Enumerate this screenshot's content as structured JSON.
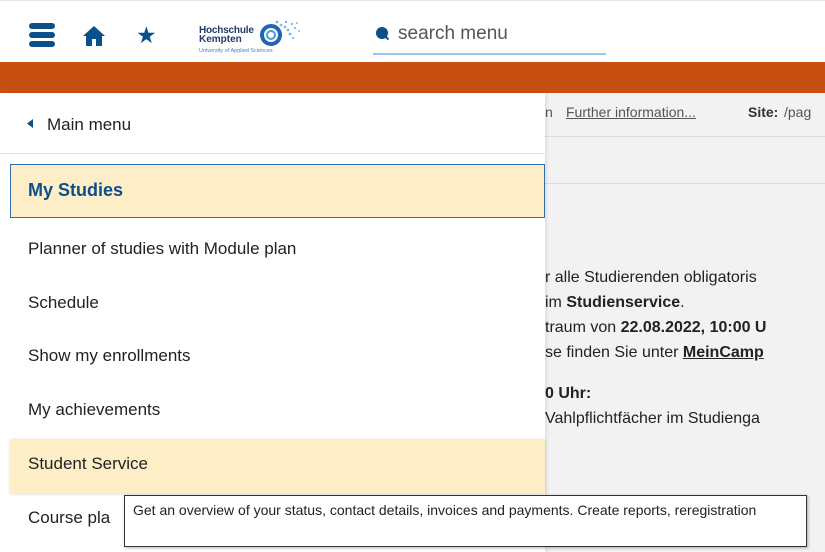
{
  "header": {
    "logo": {
      "line1": "Hochschule",
      "line2": "Kempten",
      "line3": "University of Applied Sciences"
    },
    "search_placeholder": "search menu",
    "brand_color": "#0b4f8b",
    "accent_color": "#c84f12"
  },
  "info_bar": {
    "further_info_prefix": "n",
    "further_info": "Further information...",
    "site_label": "Site:",
    "site_value": "/pag"
  },
  "background_text": {
    "l1": "r alle Studierenden obligatoris",
    "l2a": "im ",
    "l2b": "Studienservice",
    "l2c": ".",
    "l3a": "traum von ",
    "l3b": "22.08.2022, 10:00 U",
    "l4a": "se finden Sie unter ",
    "l4b": "MeinCamp",
    "l5": "0 Uhr:",
    "l6": "Vahlpflichtfächer im Studienga"
  },
  "menu": {
    "back_label": "Main menu",
    "items": [
      {
        "label": "My Studies",
        "state": "active"
      },
      {
        "label": "Planner of studies with Module plan"
      },
      {
        "label": "Schedule"
      },
      {
        "label": "Show my enrollments"
      },
      {
        "label": "My achievements"
      },
      {
        "label": "Student Service",
        "state": "hover"
      },
      {
        "label": "Course pla"
      }
    ]
  },
  "tooltip": {
    "text": "Get an overview of your status, contact details, invoices and payments. Create reports, reregistration"
  }
}
